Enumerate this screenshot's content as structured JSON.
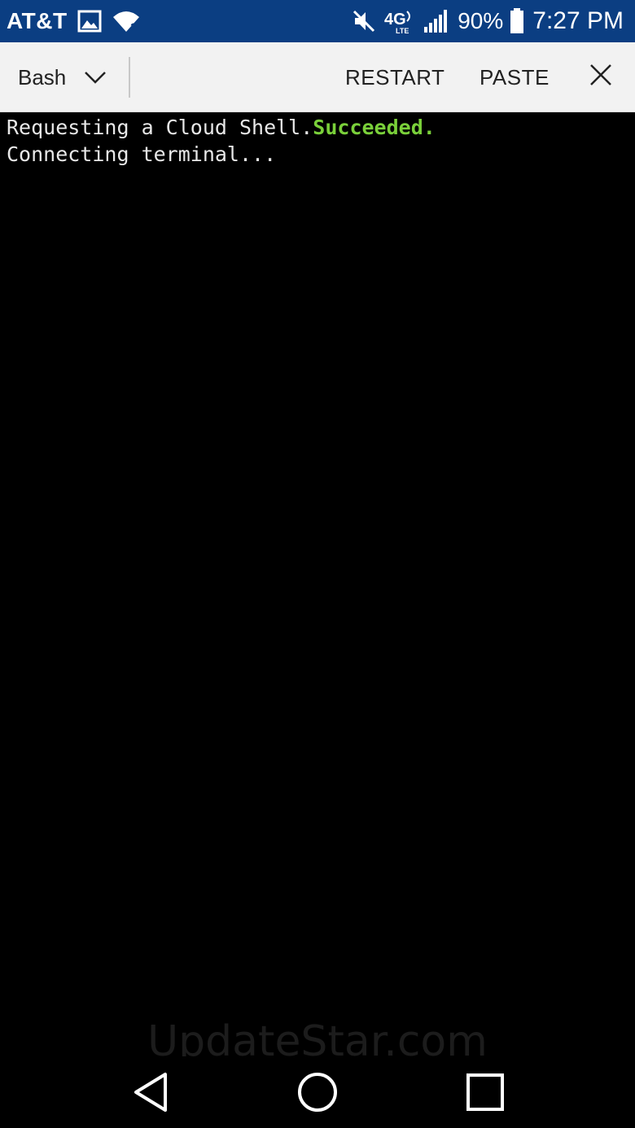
{
  "status_bar": {
    "carrier": "AT&T",
    "battery": "90%",
    "time": "7:27 PM",
    "network": "4G LTE",
    "icons": [
      "gallery-icon",
      "wifi-icon",
      "mute-icon",
      "lte-icon",
      "signal-icon",
      "battery-icon"
    ]
  },
  "toolbar": {
    "shell": "Bash",
    "restart_label": "RESTART",
    "paste_label": "PASTE"
  },
  "terminal": {
    "line1_prefix": "Requesting a Cloud Shell.",
    "line1_status": "Succeeded.",
    "line2": "Connecting terminal..."
  },
  "watermark": "UpdateStar.com",
  "colors": {
    "status_bar_bg": "#0b3e82",
    "toolbar_bg": "#f2f2f2",
    "terminal_bg": "#000000",
    "success_green": "#7ad03a"
  }
}
